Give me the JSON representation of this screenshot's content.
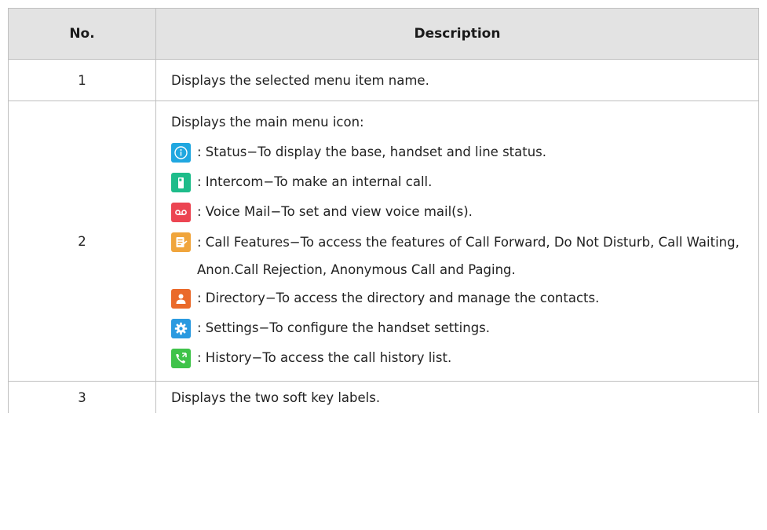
{
  "table": {
    "headers": {
      "no": "No.",
      "description": "Description"
    },
    "rows": [
      {
        "no": "1",
        "description": "Displays the selected menu item name."
      },
      {
        "no": "2",
        "intro": "Displays the main menu icon:",
        "items": [
          {
            "icon": "status-icon",
            "text": ": Status−To display the base, handset and line status."
          },
          {
            "icon": "intercom-icon",
            "text": ": Intercom−To make an internal call."
          },
          {
            "icon": "voice-mail-icon",
            "text": ": Voice Mail−To set and view voice mail(s)."
          },
          {
            "icon": "call-features-icon",
            "text": ": Call Features−To access the features of Call Forward, Do Not Disturb, Call Waiting, Anon.Call Rejection, Anonymous Call and Paging."
          },
          {
            "icon": "directory-icon",
            "text": ": Directory−To access the directory and manage the contacts."
          },
          {
            "icon": "settings-icon",
            "text": ": Settings−To configure the handset settings."
          },
          {
            "icon": "history-icon",
            "text": ": History−To access the call history list."
          }
        ]
      },
      {
        "no": "3",
        "description": "Displays the two soft key labels."
      }
    ]
  },
  "colors": {
    "header_bg": "#e3e3e3",
    "border": "#bfbfbf",
    "status": "#20a7e0",
    "intercom": "#1ebc8a",
    "voice_mail": "#ec4552",
    "call_features": "#f0a53c",
    "directory": "#ea6a2b",
    "settings": "#2a9ae0",
    "history": "#3fc34a"
  }
}
